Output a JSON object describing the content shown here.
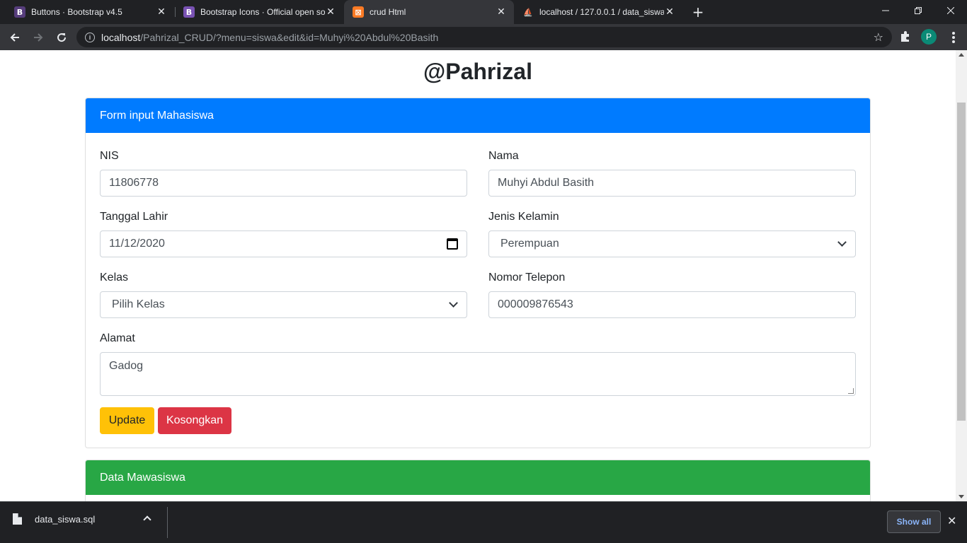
{
  "browser": {
    "tabs": [
      {
        "title": "Buttons · Bootstrap v4.5",
        "favicon_letter": "B",
        "favicon_color": "#563d7c",
        "active": false
      },
      {
        "title": "Bootstrap Icons · Official open so",
        "favicon_letter": "B",
        "favicon_color": "#7952b3",
        "active": false
      },
      {
        "title": "crud Html",
        "favicon_letter": "⊠",
        "favicon_color": "#fb7a24",
        "active": true
      },
      {
        "title": "localhost / 127.0.0.1 / data_siswa",
        "favicon_letter": "⛵",
        "favicon_color": "#202124",
        "active": false
      }
    ],
    "tab_close_glyph": "✕",
    "new_tab_glyph": "+",
    "url_host": "localhost",
    "url_path": "/Pahrizal_CRUD/?menu=siswa&edit&id=Muhyi%20Abdul%20Basith",
    "profile_initial": "P",
    "profile_color": "#0b8a76"
  },
  "page": {
    "title": "@Pahrizal"
  },
  "form_card": {
    "header": "Form input Mahasiswa",
    "header_color": "#007bff",
    "fields": {
      "nis": {
        "label": "NIS",
        "value": "11806778"
      },
      "nama": {
        "label": "Nama",
        "value": "Muhyi Abdul Basith"
      },
      "tanggal_lahir": {
        "label": "Tanggal Lahir",
        "value": "11/12/2020"
      },
      "jenis_kelamin": {
        "label": "Jenis Kelamin",
        "value": "Perempuan"
      },
      "kelas": {
        "label": "Kelas",
        "value": "Pilih Kelas"
      },
      "nomor_telepon": {
        "label": "Nomor Telepon",
        "value": "000009876543"
      },
      "alamat": {
        "label": "Alamat",
        "value": "Gadog"
      }
    },
    "buttons": {
      "update": "Update",
      "kosongkan": "Kosongkan"
    }
  },
  "data_card": {
    "header": "Data Mawasiswa",
    "header_color": "#28a745"
  },
  "downloads": {
    "file_name": "data_siswa.sql",
    "show_all": "Show all"
  }
}
